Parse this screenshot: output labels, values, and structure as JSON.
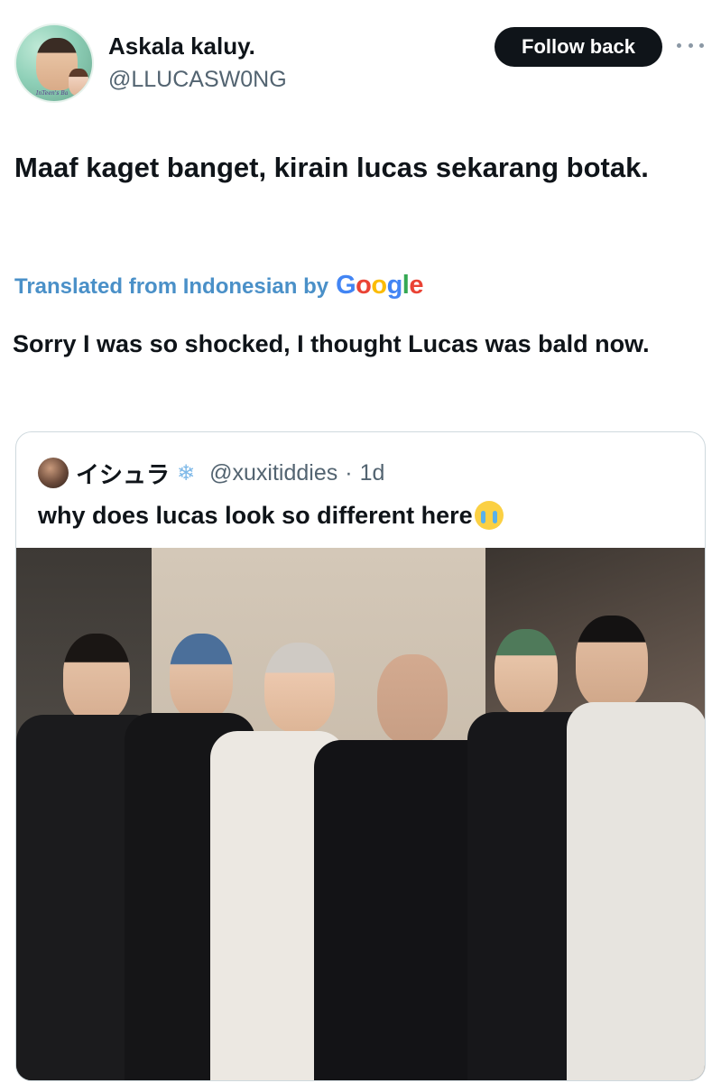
{
  "header": {
    "display_name": "Askala kaluy.",
    "handle": "@LLUCASW0NG",
    "follow_label": "Follow back",
    "avatar_caption": "InTeen's Ba"
  },
  "tweet": {
    "text": "Maaf kaget banget, kirain lucas sekarang botak.",
    "translate_label": "Translated from Indonesian by",
    "translate_provider": "Google",
    "translated_text": "Sorry I was so shocked, I thought Lucas was bald now."
  },
  "quote": {
    "name": "イシュラ",
    "name_emoji": "❄",
    "handle": "@xuxitiddies",
    "separator": "·",
    "time": "1d",
    "text": "why does lucas look so different here"
  },
  "colors": {
    "accent_link": "#4a90c8",
    "follow_bg": "#0f1419",
    "secondary_text": "#536471"
  }
}
